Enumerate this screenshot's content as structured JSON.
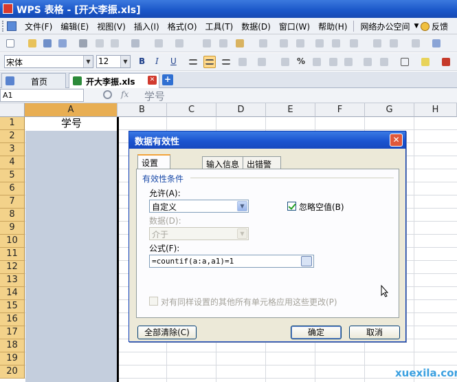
{
  "window": {
    "title": "WPS 表格 - [开大李振.xls]"
  },
  "menu": {
    "items": [
      "文件(F)",
      "编辑(E)",
      "视图(V)",
      "插入(I)",
      "格式(O)",
      "工具(T)",
      "数据(D)",
      "窗口(W)",
      "帮助(H)"
    ],
    "online": "网络办公空间",
    "feedback": "反馈"
  },
  "toolbar": {
    "font_name": "宋体",
    "font_size": "12",
    "bold": "B",
    "italic": "I",
    "underline": "U",
    "percent": "%"
  },
  "tabs": [
    {
      "label": "首页"
    },
    {
      "label": "开大李振.xls"
    }
  ],
  "formula_bar": {
    "cell_ref": "A1",
    "fx_icon": "fx",
    "content": "学号"
  },
  "grid": {
    "columns": [
      "A",
      "B",
      "C",
      "D",
      "E",
      "F",
      "G",
      "H"
    ],
    "rows": [
      "1",
      "2",
      "3",
      "4",
      "5",
      "6",
      "7",
      "8",
      "9",
      "10",
      "11",
      "12",
      "13",
      "14",
      "15",
      "16",
      "17",
      "18",
      "19",
      "20"
    ],
    "cell_a1": "学号"
  },
  "dialog": {
    "title": "数据有效性",
    "tabs": [
      "设置",
      "输入信息",
      "出错警告"
    ],
    "group_label": "有效性条件",
    "allow_label": "允许(A):",
    "allow_value": "自定义",
    "ignore_blank_label": "忽略空值(B)",
    "data_label": "数据(D):",
    "data_value": "介于",
    "formula_label": "公式(F):",
    "formula_value": "=countif(a:a,a1)=1",
    "apply_all_label": "对有同样设置的其他所有单元格应用这些更改(P)",
    "clear_button": "全部清除(C)",
    "ok_button": "确定",
    "cancel_button": "取消"
  },
  "watermark": "xuexila.com"
}
